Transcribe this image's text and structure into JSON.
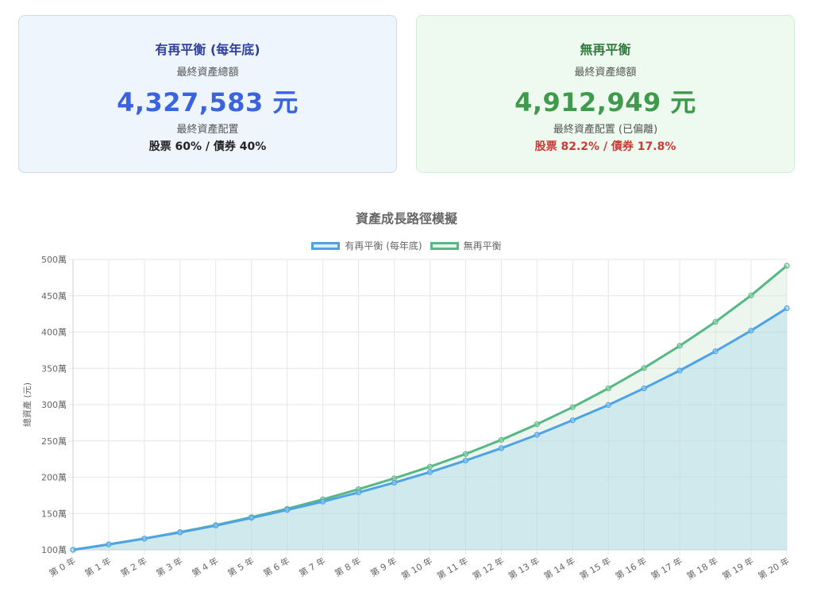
{
  "cards": {
    "rebalance": {
      "title": "有再平衡 (每年底)",
      "total_label": "最終資產總額",
      "total_value": "4,327,583 元",
      "alloc_label": "最終資產配置",
      "alloc_value": "股票 60% / 債券 40%"
    },
    "no_rebalance": {
      "title": "無再平衡",
      "total_label": "最終資產總額",
      "total_value": "4,912,949 元",
      "alloc_label": "最終資產配置 (已偏離)",
      "alloc_value": "股票 82.2% / 債券 17.8%"
    }
  },
  "colors": {
    "rebalance_line": "#4da3e6",
    "rebalance_fill": "rgba(176,218,235,0.45)",
    "no_rebalance_line": "#56b884",
    "no_rebalance_fill": "rgba(200,230,205,0.35)",
    "grid": "#e6e6e6"
  },
  "chart_data": {
    "type": "line",
    "title": "資產成長路徑模擬",
    "ylabel": "總資產 (元)",
    "xlabel": "",
    "legend_position": "top",
    "grid": true,
    "categories": [
      "第 0 年",
      "第 1 年",
      "第 2 年",
      "第 3 年",
      "第 4 年",
      "第 5 年",
      "第 6 年",
      "第 7 年",
      "第 8 年",
      "第 9 年",
      "第 10 年",
      "第 11 年",
      "第 12 年",
      "第 13 年",
      "第 14 年",
      "第 15 年",
      "第 16 年",
      "第 17 年",
      "第 18 年",
      "第 19 年",
      "第 20 年"
    ],
    "ylim": [
      1000000,
      5000000
    ],
    "yticks": [
      {
        "value": 1000000,
        "label": "100萬"
      },
      {
        "value": 1500000,
        "label": "150萬"
      },
      {
        "value": 2000000,
        "label": "200萬"
      },
      {
        "value": 2500000,
        "label": "250萬"
      },
      {
        "value": 3000000,
        "label": "300萬"
      },
      {
        "value": 3500000,
        "label": "350萬"
      },
      {
        "value": 4000000,
        "label": "400萬"
      },
      {
        "value": 4500000,
        "label": "450萬"
      },
      {
        "value": 5000000,
        "label": "500萬"
      }
    ],
    "series": [
      {
        "name": "有再平衡 (每年底)",
        "values": [
          1000000,
          1075000,
          1155000,
          1240000,
          1335000,
          1440000,
          1550000,
          1665000,
          1790000,
          1925000,
          2070000,
          2230000,
          2400000,
          2585000,
          2785000,
          2995000,
          3225000,
          3470000,
          3735000,
          4020000,
          4327583
        ]
      },
      {
        "name": "無再平衡",
        "values": [
          1000000,
          1075000,
          1155000,
          1245000,
          1340000,
          1450000,
          1565000,
          1695000,
          1835000,
          1985000,
          2145000,
          2320000,
          2515000,
          2730000,
          2965000,
          3225000,
          3505000,
          3810000,
          4140000,
          4505000,
          4912949
        ]
      }
    ]
  }
}
